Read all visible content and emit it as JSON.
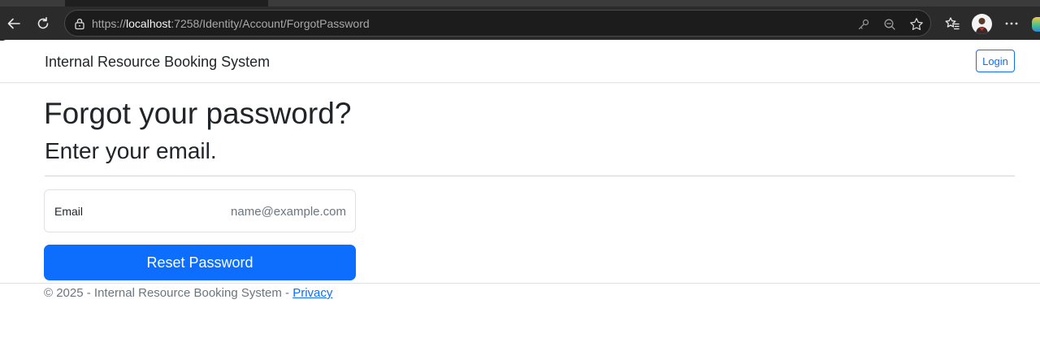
{
  "browser": {
    "url_prefix": "https://",
    "url_host": "localhost",
    "url_path": ":7258/Identity/Account/ForgotPassword",
    "icons": [
      "back-arrow-icon",
      "refresh-icon",
      "lock-icon",
      "key-icon",
      "zoom-icon",
      "star-icon",
      "favorites-icon",
      "more-icon"
    ]
  },
  "navbar": {
    "brand": "Internal Resource Booking System",
    "login_label": "Login"
  },
  "main": {
    "title": "Forgot your password?",
    "subtitle": "Enter your email.",
    "email_label": "Email",
    "email_placeholder": "name@example.com",
    "email_value": "",
    "submit_label": "Reset Password"
  },
  "footer": {
    "text": "© 2025 - Internal Resource Booking System - ",
    "privacy_label": "Privacy"
  },
  "colors": {
    "primary": "#0d6efd",
    "text": "#212529",
    "muted": "#6c757d",
    "chrome_dark": "#2b2b2b"
  }
}
